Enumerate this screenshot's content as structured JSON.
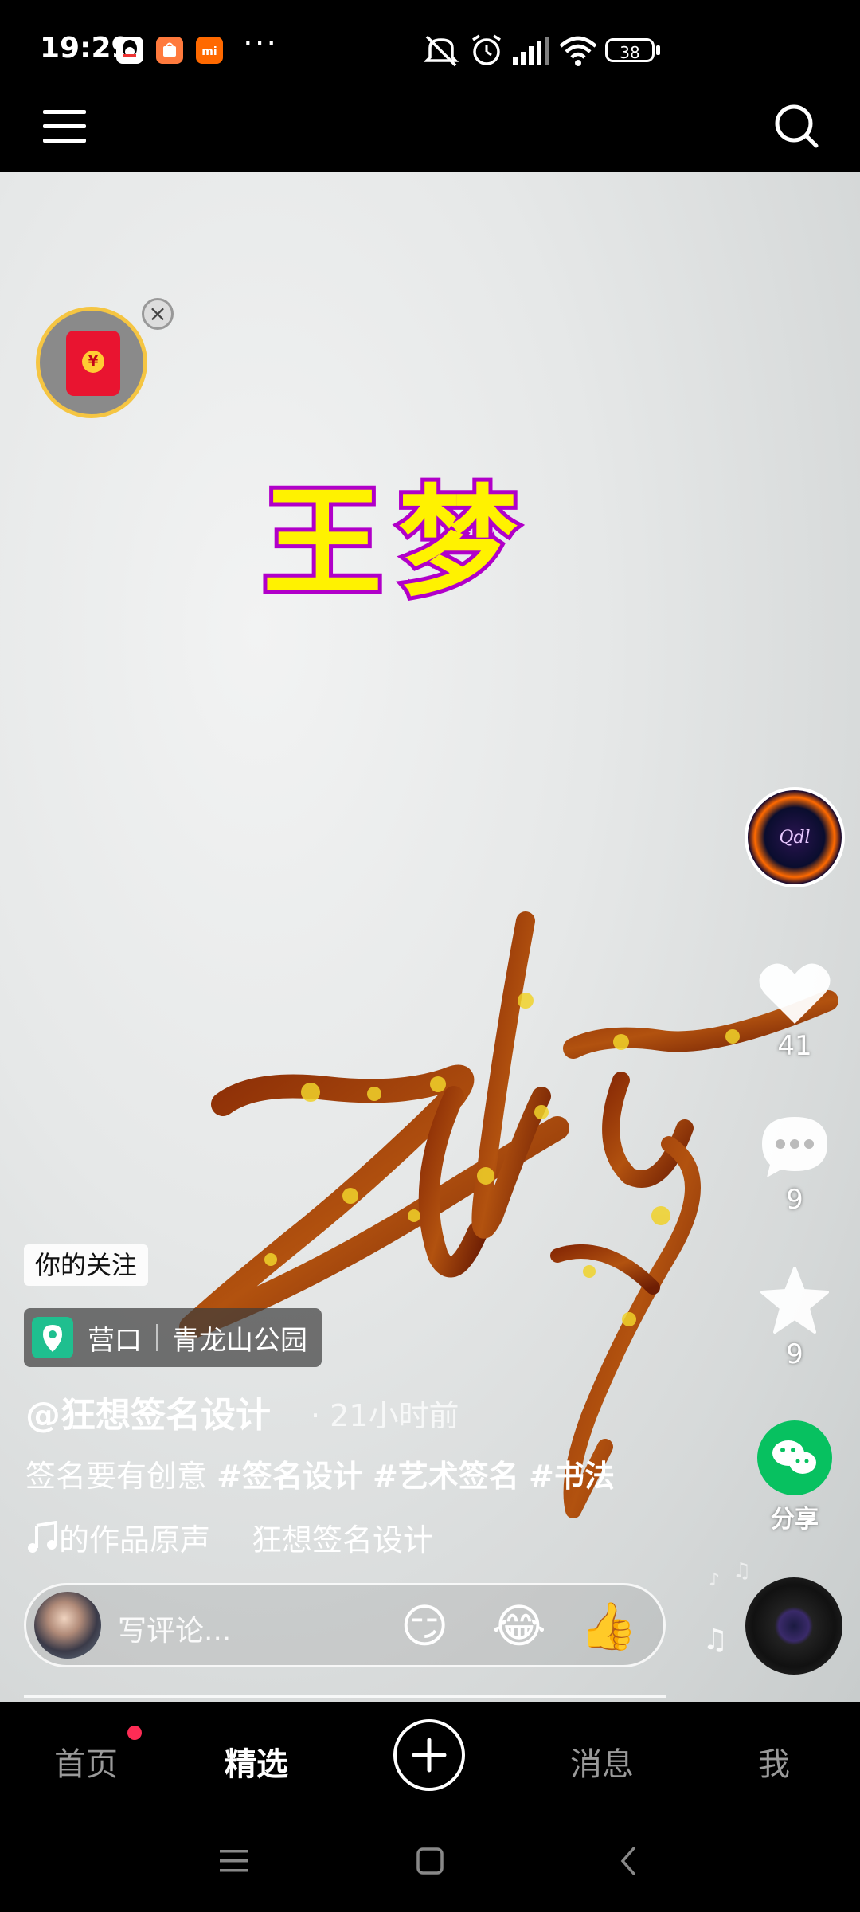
{
  "status_bar": {
    "time": "19:29",
    "dots": "···",
    "battery": "38",
    "icons": [
      "qq-icon",
      "mi-store-icon",
      "mi-icon",
      "mute-icon",
      "alarm-icon",
      "signal-icon",
      "wifi-icon",
      "battery-icon"
    ]
  },
  "top_bar": {
    "menu_icon": "menu-icon",
    "search_icon": "search-icon"
  },
  "video": {
    "overlay_title": "王梦"
  },
  "side_actions": {
    "like_count": "41",
    "comment_count": "9",
    "favorite_count": "9",
    "share_label": "分享"
  },
  "info": {
    "follow_badge": "你的关注",
    "location_city": "营口",
    "location_place": "青龙山公园",
    "author": "@狂想签名设计",
    "time_ago": "21小时前",
    "caption_text": "签名要有创意",
    "hashtags": [
      "#签名设计",
      "#艺术签名",
      "#书法"
    ],
    "music_original": "的作品原声",
    "music_author": "狂想签名设计"
  },
  "comment": {
    "placeholder": "写评论...",
    "emojis": [
      "😏",
      "😂",
      "👍"
    ]
  },
  "bottom_nav": {
    "home": "首页",
    "featured": "精选",
    "messages": "消息",
    "me": "我"
  },
  "colors": {
    "accent_red": "#fe2c55",
    "share_green": "#07c160",
    "title_yellow": "#fff200",
    "title_outline": "#b100c9"
  }
}
